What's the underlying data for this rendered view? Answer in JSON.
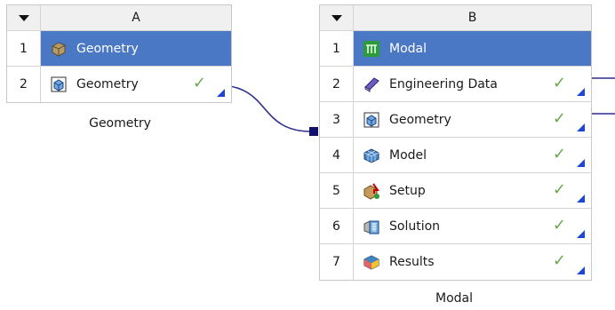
{
  "systems": {
    "a": {
      "letter": "A",
      "caption": "Geometry",
      "rows": [
        {
          "num": "1",
          "label": "Geometry",
          "icon": "geometry-solid-icon",
          "selected": true,
          "status": ""
        },
        {
          "num": "2",
          "label": "Geometry",
          "icon": "geometry-cube-icon",
          "selected": false,
          "status": "✓"
        }
      ]
    },
    "b": {
      "letter": "B",
      "caption": "Modal",
      "rows": [
        {
          "num": "1",
          "label": "Modal",
          "icon": "modal-icon",
          "selected": true,
          "status": ""
        },
        {
          "num": "2",
          "label": "Engineering Data",
          "icon": "engineering-data-icon",
          "selected": false,
          "status": "✓"
        },
        {
          "num": "3",
          "label": "Geometry",
          "icon": "geometry-cube-icon",
          "selected": false,
          "status": "✓"
        },
        {
          "num": "4",
          "label": "Model",
          "icon": "model-mesh-icon",
          "selected": false,
          "status": "✓"
        },
        {
          "num": "5",
          "label": "Setup",
          "icon": "setup-icon",
          "selected": false,
          "status": "✓"
        },
        {
          "num": "6",
          "label": "Solution",
          "icon": "solution-icon",
          "selected": false,
          "status": "✓"
        },
        {
          "num": "7",
          "label": "Results",
          "icon": "results-icon",
          "selected": false,
          "status": "✓"
        }
      ]
    }
  },
  "colors": {
    "selected_row": "#4a78c4",
    "check": "#6aa84f",
    "link": "#2b2f8a",
    "update_marker": "#1e46d2"
  }
}
